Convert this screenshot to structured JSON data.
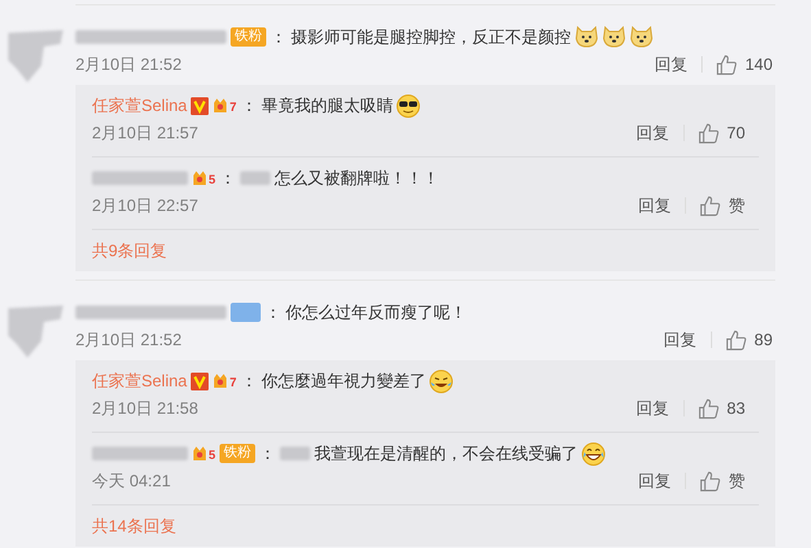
{
  "comments": [
    {
      "fan_badge": {
        "text": "铁粉",
        "color": "#f5a623"
      },
      "colon": "：",
      "text": "摄影师可能是腿控脚控，反正不是颜控",
      "emojis": [
        {
          "kind": "dog"
        },
        {
          "kind": "dog"
        },
        {
          "kind": "dog"
        }
      ],
      "time": "2月10日 21:52",
      "reply_label": "回复",
      "likes": "140",
      "replies": [
        {
          "author": "任家萱Selina",
          "verified": true,
          "level": "7",
          "colon": "：",
          "text": "畢竟我的腿太吸睛",
          "emojis": [
            {
              "kind": "cool"
            }
          ],
          "time": "2月10日 21:57",
          "reply_label": "回复",
          "likes": "70"
        },
        {
          "level": "5",
          "colon": "：",
          "text": "怎么又被翻牌啦！！！",
          "time": "2月10日 22:57",
          "reply_label": "回复",
          "likes": "赞"
        }
      ],
      "more": "共9条回复"
    },
    {
      "fan_badge": {
        "color": "#7fb2ea"
      },
      "colon": "：",
      "text": "你怎么过年反而瘦了呢！",
      "time": "2月10日 21:52",
      "reply_label": "回复",
      "likes": "89",
      "replies": [
        {
          "author": "任家萱Selina",
          "verified": true,
          "level": "7",
          "colon": "：",
          "text": "你怎麼過年視力變差了",
          "emojis": [
            {
              "kind": "laughcry"
            }
          ],
          "time": "2月10日 21:58",
          "reply_label": "回复",
          "likes": "83"
        },
        {
          "level": "5",
          "fan_badge": {
            "text": "铁粉",
            "color": "#f5a623"
          },
          "colon": "：",
          "text": "我萱现在是清醒的，不会在线受骗了",
          "emojis": [
            {
              "kind": "grin"
            }
          ],
          "time": "今天 04:21",
          "reply_label": "回复",
          "likes": "赞"
        }
      ],
      "more": "共14条回复"
    }
  ]
}
